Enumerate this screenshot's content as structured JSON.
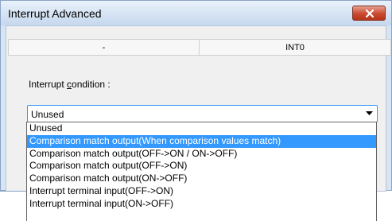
{
  "window": {
    "title": "Interrupt Advanced",
    "close_icon": "close-x-icon"
  },
  "table": {
    "headers": [
      "-",
      "INT0"
    ]
  },
  "condition": {
    "label_prefix": "Interrupt ",
    "label_accel": "c",
    "label_suffix": "ondition :",
    "selected_value": "Unused",
    "options": [
      "Unused",
      "Comparison match output(When comparison values match)",
      "Comparison match output(OFF->ON / ON->OFF)",
      "Comparison match output(OFF->ON)",
      "Comparison match output(ON->OFF)",
      "Interrupt terminal input(OFF->ON)",
      "Interrupt terminal input(ON->OFF)"
    ],
    "highlighted_index": 1
  },
  "colors": {
    "highlight": "#3399ff",
    "close_button": "#c94a30"
  }
}
